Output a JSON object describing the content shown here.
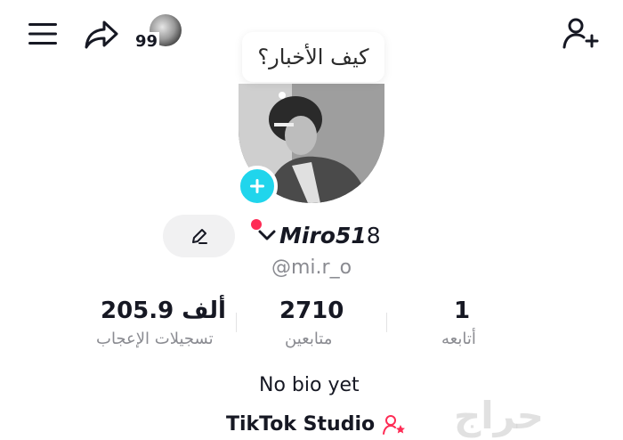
{
  "header": {
    "menu_icon": "hamburger-menu-icon",
    "share_icon": "share-arrow-icon",
    "badge_count": "99",
    "add_friend_icon": "person-add-icon"
  },
  "bubble": {
    "text": "كيف الأخبار؟"
  },
  "profile": {
    "username_main": "Miro51",
    "username_tail": "8",
    "handle": "@mi.r_o"
  },
  "stats": [
    {
      "value": "1",
      "label": "أتابعه"
    },
    {
      "value": "2710",
      "label": "متابعين"
    },
    {
      "value": "205.9 ألف",
      "label": "تسجيلات الإعجاب"
    }
  ],
  "bio": "No bio yet",
  "studio": {
    "label": "TikTok Studio"
  },
  "watermark": "حراج",
  "colors": {
    "accent_cyan": "#20d5ec",
    "accent_red": "#fe2c55",
    "muted": "#8a8b91",
    "text": "#161823"
  }
}
